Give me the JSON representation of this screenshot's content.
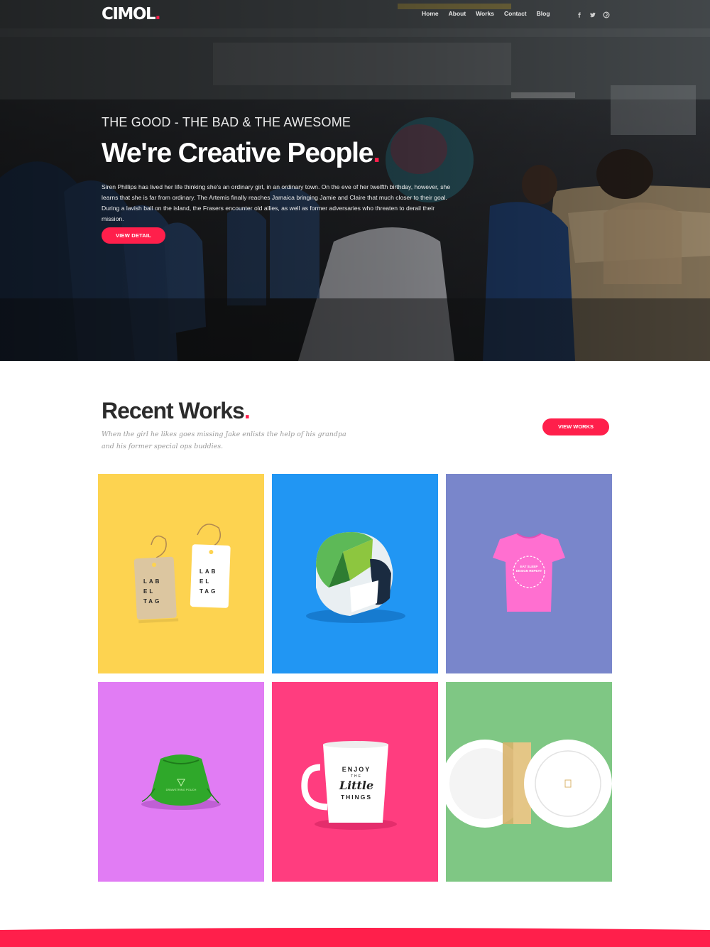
{
  "brand": {
    "name": "CIMOL",
    "dot": ".",
    "accent": "#ff1f4b"
  },
  "nav": {
    "items": [
      "Home",
      "About",
      "Works",
      "Contact",
      "Blog"
    ]
  },
  "social": [
    "facebook-icon",
    "twitter-icon",
    "pinterest-icon"
  ],
  "hero": {
    "kicker": "THE GOOD - THE BAD & THE AWESOME",
    "headline": "We're Creative People",
    "headline_dot": ".",
    "lead": "Siren Phillips has lived her life thinking she's an ordinary girl, in an ordinary town. On the eve of her twelfth birthday, however, she learns that she is far from ordinary. The Artemis finally reaches Jamaica bringing Jamie and Claire that much closer to their goal. During a lavish ball on the island, the Frasers encounter old allies, as well as former adversaries who threaten to derail their mission.",
    "button": "VIEW DETAIL"
  },
  "works": {
    "title": "Recent Works",
    "title_dot": ".",
    "subtitle": "When the girl he likes goes missing Jake enlists the help of his grandpa and his former special ops buddies.",
    "button": "VIEW WORKS",
    "items": [
      {
        "name": "label-tags",
        "color": "#fdd350",
        "tag_text_1": "LAB EL TAG",
        "tag_text_2": "LAB EL TAG"
      },
      {
        "name": "helmet",
        "color": "#2196f3"
      },
      {
        "name": "tshirt",
        "color": "#7986cb",
        "print": "EAT SLEEP DESIGN REPEAT"
      },
      {
        "name": "drawstring-pouch",
        "color": "#e17cf4",
        "print": "DRAWSTRING POUCH"
      },
      {
        "name": "mug",
        "color": "#ff3d7f",
        "line1": "ENJOY",
        "line2": "THE",
        "line3": "Little",
        "line4": "THINGS"
      },
      {
        "name": "plates",
        "color": "#7fc784"
      }
    ]
  }
}
